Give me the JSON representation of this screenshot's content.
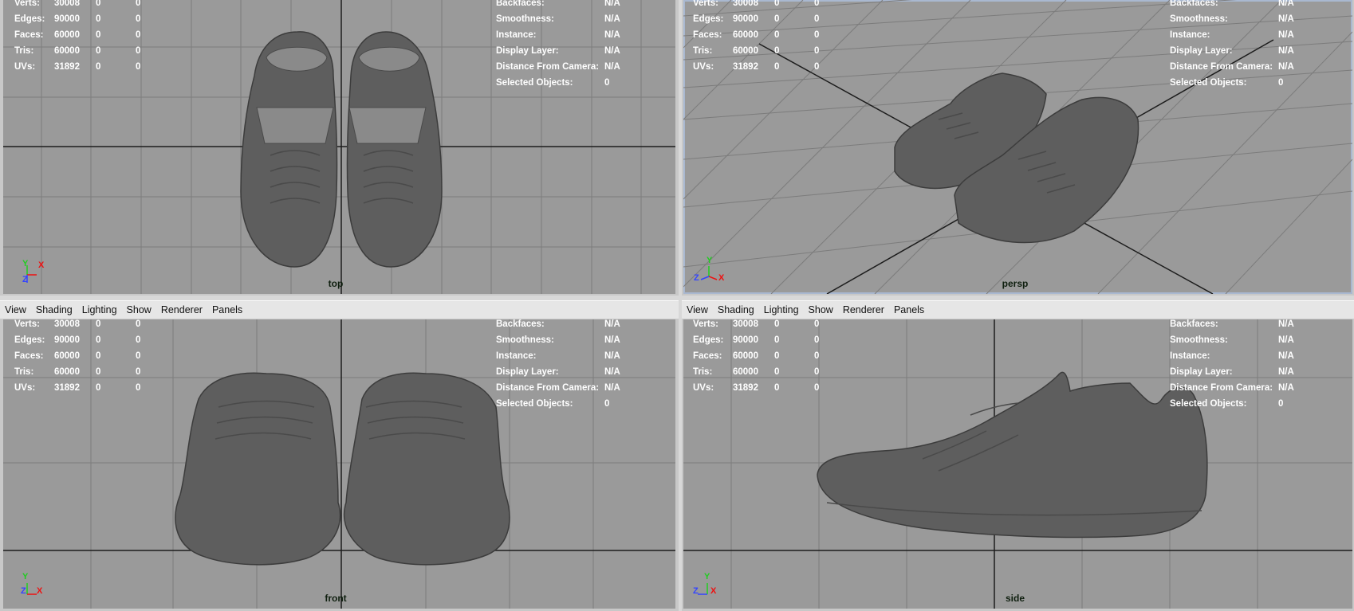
{
  "menu": [
    "View",
    "Shading",
    "Lighting",
    "Show",
    "Renderer",
    "Panels"
  ],
  "stats": [
    {
      "label": "Verts:",
      "v1": "30008",
      "v2": "0",
      "v3": "0"
    },
    {
      "label": "Edges:",
      "v1": "90000",
      "v2": "0",
      "v3": "0"
    },
    {
      "label": "Faces:",
      "v1": "60000",
      "v2": "0",
      "v3": "0"
    },
    {
      "label": "Tris:",
      "v1": "60000",
      "v2": "0",
      "v3": "0"
    },
    {
      "label": "UVs:",
      "v1": "31892",
      "v2": "0",
      "v3": "0"
    }
  ],
  "info": [
    {
      "label": "Backfaces:",
      "value": "N/A"
    },
    {
      "label": "Smoothness:",
      "value": "N/A"
    },
    {
      "label": "Instance:",
      "value": "N/A"
    },
    {
      "label": "Display Layer:",
      "value": "N/A"
    },
    {
      "label": "Distance From Camera:",
      "value": "N/A"
    },
    {
      "label": "Selected Objects:",
      "value": "0"
    }
  ],
  "panes": {
    "top": {
      "camera": "top",
      "axes": {
        "a": "Y",
        "b": "X",
        "c": "Z"
      }
    },
    "persp": {
      "camera": "persp",
      "axes": {
        "a": "Y",
        "b": "X",
        "c": "Z"
      }
    },
    "front": {
      "camera": "front",
      "axes": {
        "a": "Y",
        "b": "X",
        "c": "Z"
      }
    },
    "side": {
      "camera": "side",
      "axes": {
        "a": "Y",
        "b": "X",
        "c": "Z"
      }
    }
  },
  "colors": {
    "viewport_bg": "#9a9a9a",
    "grid": "#7c7c7c",
    "axis_line": "#1c1c1c",
    "hud_text": "#ffffff",
    "camera_label": "#0f1f0f",
    "mesh": "#5e5e5e"
  }
}
